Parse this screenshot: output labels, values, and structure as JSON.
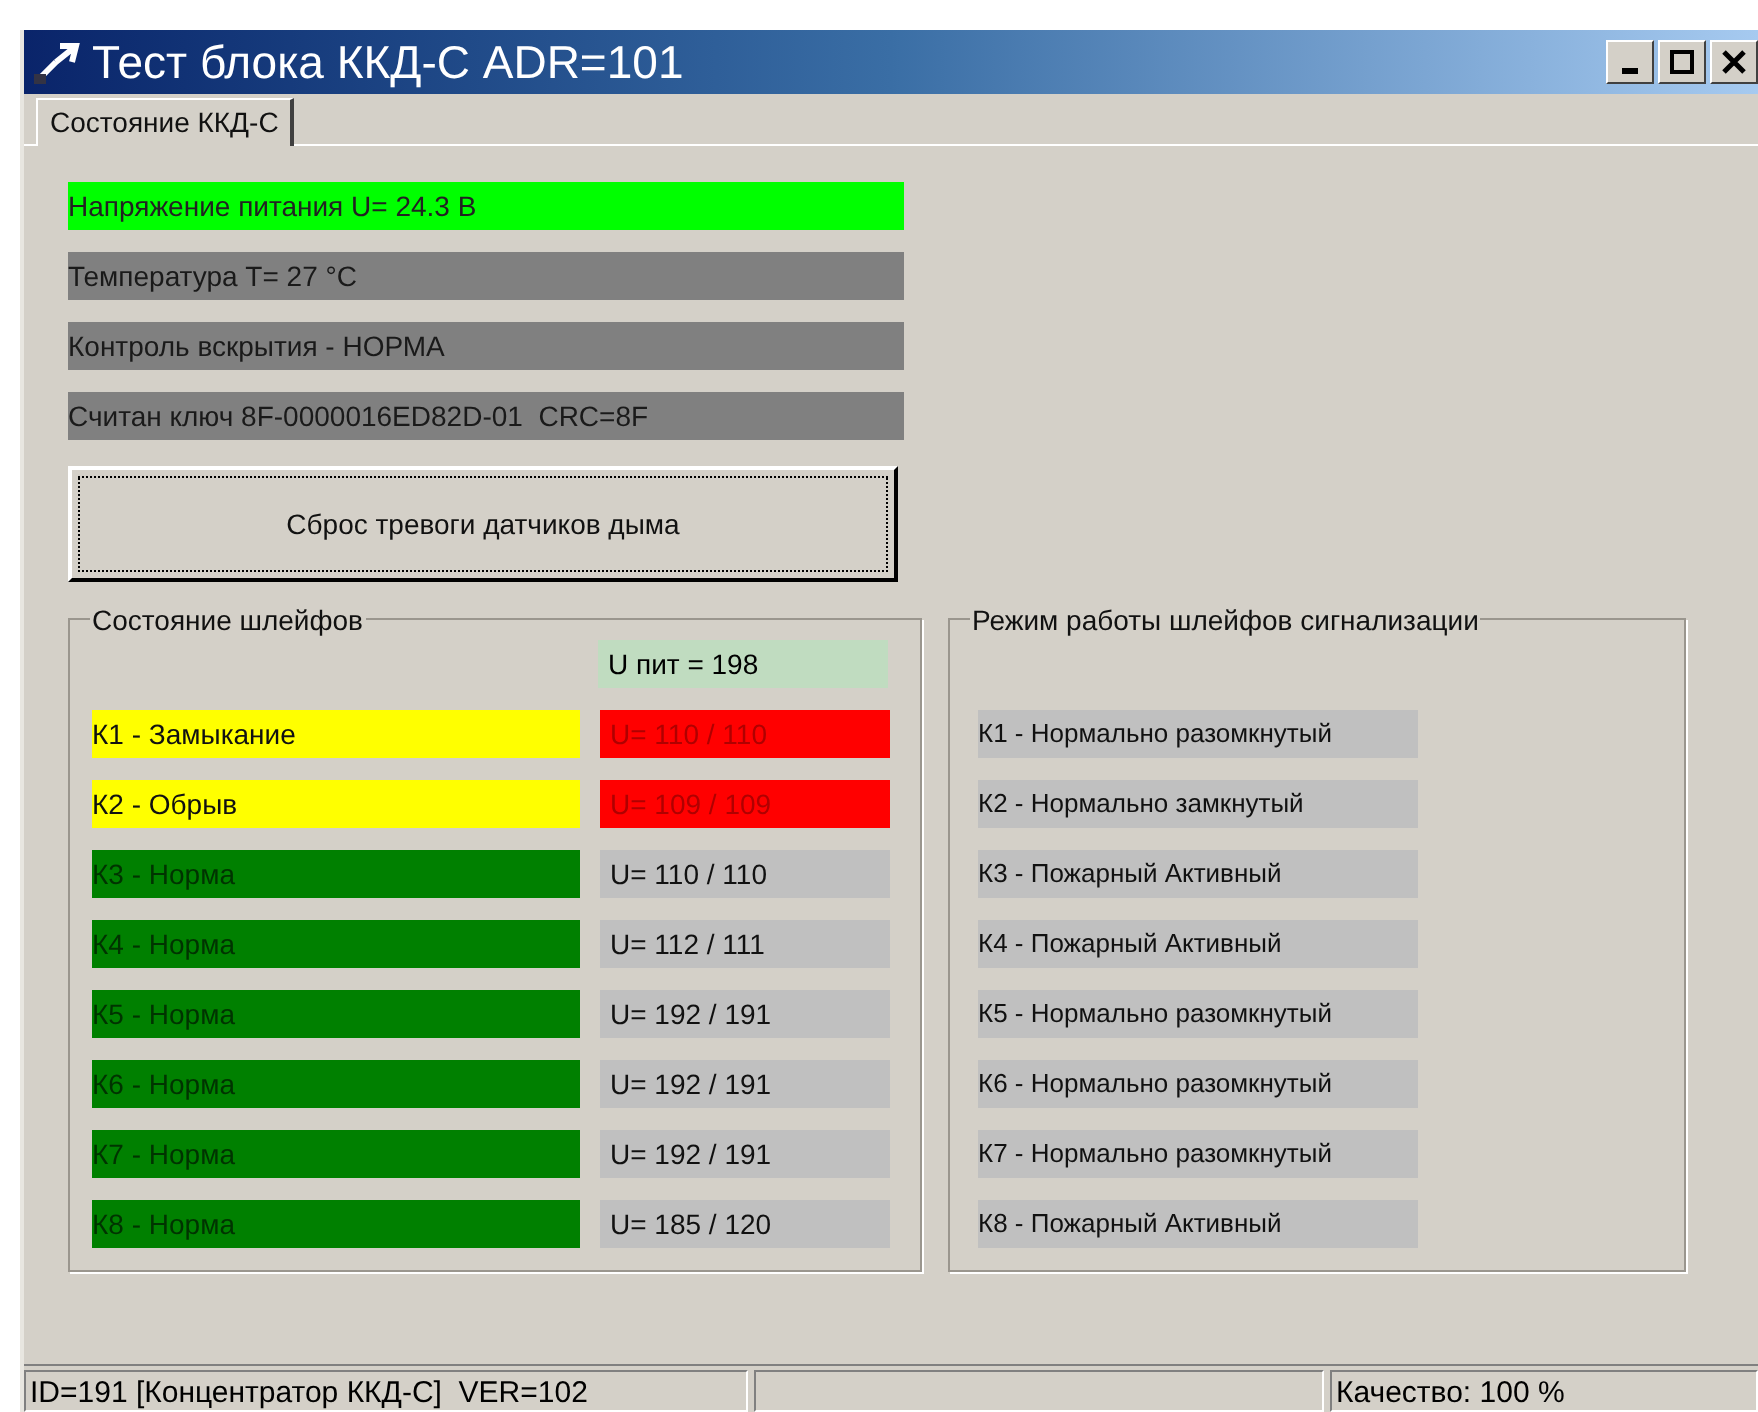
{
  "window": {
    "title": "Тест блока ККД-С ADR=101"
  },
  "tabs": [
    {
      "label": "Состояние ККД-С",
      "selected": true
    }
  ],
  "indicators": [
    {
      "text": "Напряжение питания U= 24.3 В",
      "ok": true
    },
    {
      "text": "Температура Т= 27 °С",
      "ok": false
    },
    {
      "text": "Контроль вскрытия - НОРМА",
      "ok": false
    },
    {
      "text": "Считан ключ 8F-0000016ED82D-01  CRC=8F",
      "ok": false
    }
  ],
  "reset_button": "Сброс тревоги датчиков дыма",
  "loops": {
    "title": "Состояние шлейфов",
    "supply": "U пит = 198",
    "rows": [
      {
        "status": "К1 - Замыкание",
        "alarm": true,
        "voltage": "U= 110 / 110",
        "fault": true
      },
      {
        "status": "К2 - Обрыв",
        "alarm": true,
        "voltage": "U= 109 / 109",
        "fault": true
      },
      {
        "status": "К3 - Норма",
        "alarm": false,
        "voltage": "U= 110 / 110",
        "fault": false
      },
      {
        "status": "К4 - Норма",
        "alarm": false,
        "voltage": "U= 112 / 111",
        "fault": false
      },
      {
        "status": "К5 - Норма",
        "alarm": false,
        "voltage": "U= 192 / 191",
        "fault": false
      },
      {
        "status": "К6 - Норма",
        "alarm": false,
        "voltage": "U= 192 / 191",
        "fault": false
      },
      {
        "status": "К7 - Норма",
        "alarm": false,
        "voltage": "U= 192 / 191",
        "fault": false
      },
      {
        "status": "К8 - Норма",
        "alarm": false,
        "voltage": "U= 185 / 120",
        "fault": false
      }
    ]
  },
  "modes": {
    "title": "Режим работы шлейфов сигнализации",
    "rows": [
      "К1 - Нормально разомкнутый",
      "К2 - Нормально замкнутый",
      "К3 - Пожарный Активный",
      "К4 - Пожарный Активный",
      "К5 - Нормально разомкнутый",
      "К6 - Нормально разомкнутый",
      "К7 - Нормально разомкнутый",
      "К8 - Пожарный Активный"
    ]
  },
  "status_bar": [
    "ID=191 [Концентратор ККД-С]  VER=102",
    "Качество: 100 %"
  ]
}
